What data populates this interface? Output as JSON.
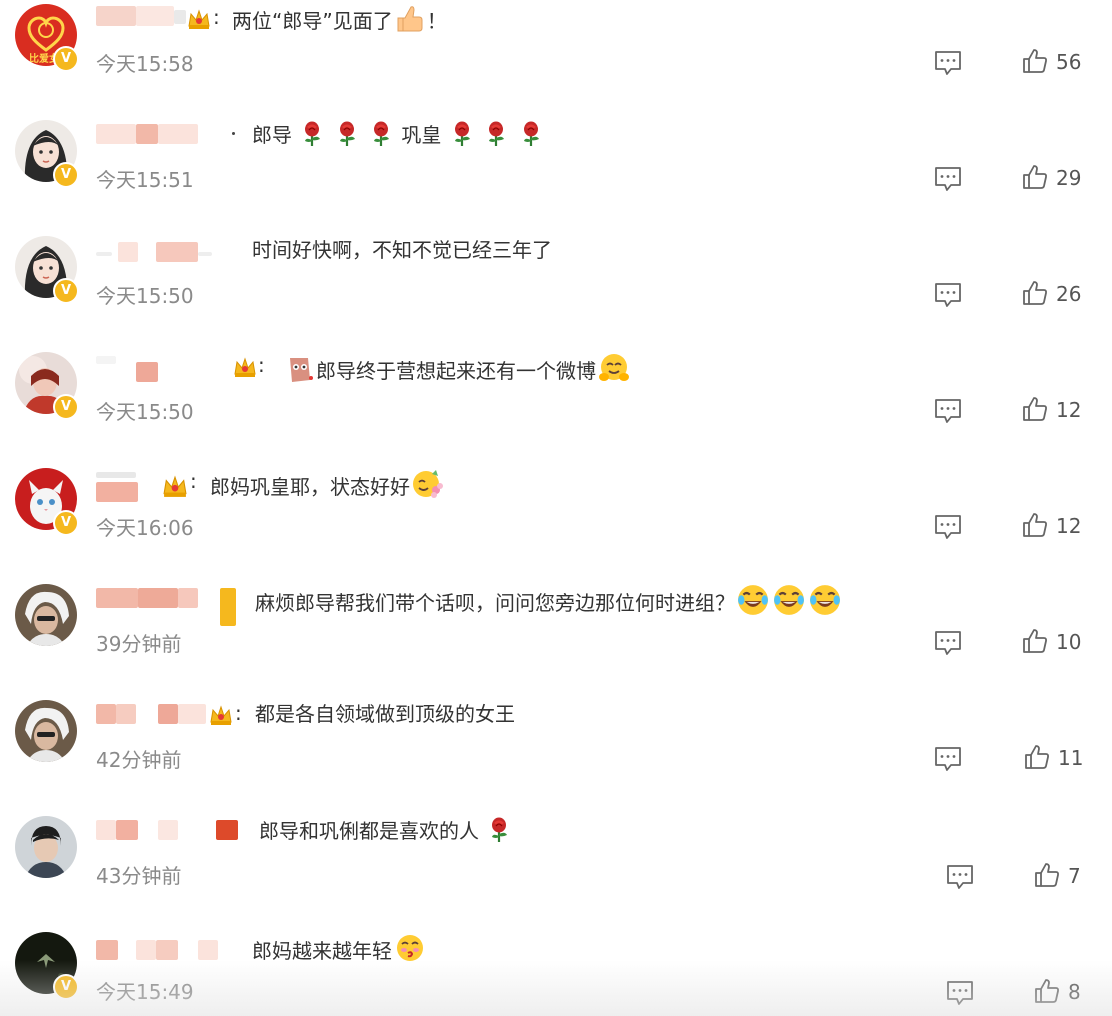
{
  "comments": [
    {
      "text": "两位“郎导”见面了",
      "suffix": "！",
      "time": "今天15:58",
      "likes": "56"
    },
    {
      "text": "郎导",
      "text2": "巩皇",
      "time": "今天15:51",
      "likes": "29"
    },
    {
      "text": "时间好快啊，不知不觉已经三年了",
      "time": "今天15:50",
      "likes": "26"
    },
    {
      "text": "郎导终于营想起来还有一个微博",
      "time": "今天15:50",
      "likes": "12"
    },
    {
      "text": "郎妈巩皇耶，状态好好",
      "time": "今天16:06",
      "likes": "12"
    },
    {
      "text": "麻烦郎导帮我们带个话呗，问问您旁边那位何时进组？",
      "time": "39分钟前",
      "likes": "10"
    },
    {
      "text": "都是各自领域做到顶级的女王",
      "time": "42分钟前",
      "likes": "11"
    },
    {
      "text": "郎导和巩俐都是喜欢的人",
      "time": "43分钟前",
      "likes": "7"
    },
    {
      "text": "郎妈越来越年轻",
      "time": "今天15:49",
      "likes": "8"
    }
  ],
  "punctuation": {
    "colon": ":"
  },
  "icons": {
    "verified_badge": "verified-v-icon",
    "crown": "crown-icon",
    "reply": "comment-bubble-icon",
    "like": "thumbs-up-icon",
    "rose": "rose-emoji",
    "thumb": "thumbs-up-emoji",
    "laugh": "laughing-tears-emoji",
    "flower_face": "flower-face-emoji",
    "hug": "hug-emoji",
    "kiss": "kiss-emoji"
  },
  "colors": {
    "verified": "#f5b81e",
    "timestamp": "#8a8a8a",
    "text": "#333333",
    "blur_name": "#f2b8a8"
  },
  "badge_letter": "V",
  "avatar_text": "比爱女"
}
